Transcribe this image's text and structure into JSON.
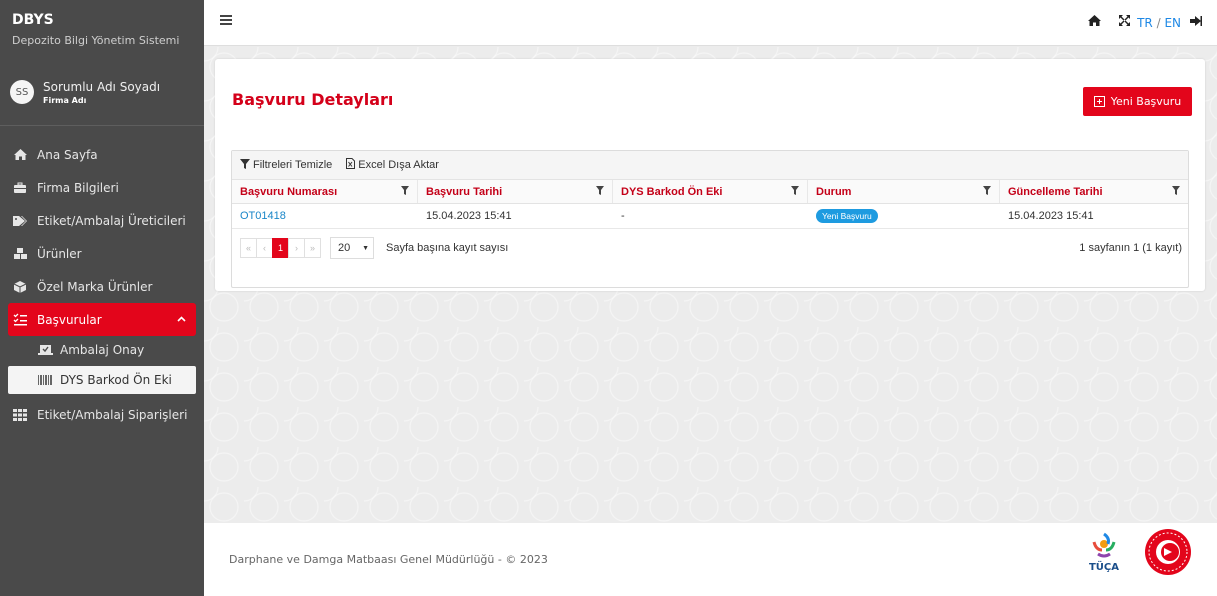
{
  "brand": {
    "title": "DBYS",
    "subtitle": "Depozito Bilgi Yönetim Sistemi"
  },
  "user": {
    "initials": "SS",
    "name": "Sorumlu Adı Soyadı",
    "firm": "Firma Adı"
  },
  "nav": {
    "items": [
      {
        "label": "Ana Sayfa",
        "icon": "home-icon"
      },
      {
        "label": "Firma Bilgileri",
        "icon": "briefcase-icon"
      },
      {
        "label": "Etiket/Ambalaj Üreticileri",
        "icon": "tags-icon"
      },
      {
        "label": "Ürünler",
        "icon": "cubes-icon"
      },
      {
        "label": "Özel Marka Ürünler",
        "icon": "box-icon"
      },
      {
        "label": "Başvurular",
        "icon": "list-check-icon"
      },
      {
        "label": "Etiket/Ambalaj Siparişleri",
        "icon": "grid-icon"
      }
    ],
    "sub": [
      {
        "label": "Ambalaj Onay",
        "icon": "laptop-check-icon"
      },
      {
        "label": "DYS Barkod Ön Eki",
        "icon": "barcode-icon"
      }
    ]
  },
  "topbar": {
    "lang_tr": "TR",
    "lang_sep": "/",
    "lang_en": "EN"
  },
  "page": {
    "title": "Başvuru Detayları",
    "new_button": "Yeni Başvuru"
  },
  "grid": {
    "toolbar": {
      "clear_filters": "Filtreleri Temizle",
      "export": "Excel Dışa Aktar"
    },
    "columns": [
      "Başvuru Numarası",
      "Başvuru Tarihi",
      "DYS Barkod Ön Eki",
      "Durum",
      "Güncelleme Tarihi"
    ],
    "rows": [
      {
        "number": "OT01418",
        "date": "15.04.2023 15:41",
        "prefix": "-",
        "status": "Yeni Başvuru",
        "updated": "15.04.2023 15:41"
      }
    ],
    "pager": {
      "first": "«",
      "prev": "‹",
      "page": "1",
      "next": "›",
      "last": "»",
      "page_size": "20",
      "page_size_label": "Sayfa başına kayıt sayısı",
      "info": "1 sayfanın 1 (1 kayıt)"
    }
  },
  "footer": {
    "text": "Darphane ve Damga Matbaası Genel Müdürlüğü - © 2023",
    "logo_text": "TÜÇA"
  },
  "colors": {
    "accent": "#e3051b",
    "sidebar": "#4a4a4a",
    "link": "#1a86c8",
    "badge": "#1e9be0"
  }
}
